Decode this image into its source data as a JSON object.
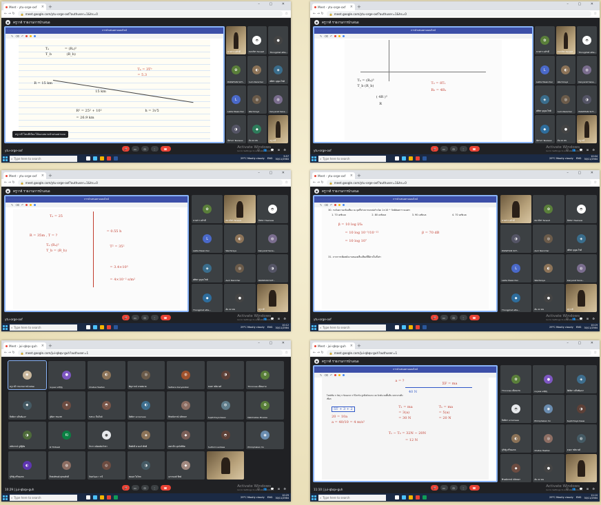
{
  "browser": {
    "tab_title": "Meet - ytu-orge-oxf",
    "tab_title_jui": "Meet - jui-qbqv-guh",
    "new_tab": "+",
    "window_controls": "–  ▢  ✕",
    "nav": "←  →  ↻",
    "url": "meet.google.com/ytu-orge-oxf?authuser=1&hs=0",
    "url_jui": "meet.google.com/jui-qbqv-guh?authuser=1"
  },
  "meet": {
    "presenter_banner": "ครูวาดี รายงานการนำเสนอ",
    "slide_app_title": "การนำเสนอทางออนไลน์",
    "chat_caption": "ครูวาดี โหนทีเนียง ได้มอบหมายนำเสนอผ่านจอ",
    "meeting_code_1": "ytu-orge-oxf",
    "meeting_code_5": "10:29  |  jui-qbqv-guh",
    "meeting_code_6": "11:10  |  jui-qbqv-guh",
    "activate_line1": "Activate Windows",
    "activate_line2": "Go to Settings to activate Windows.",
    "controls": {
      "mic": "🎤",
      "cam": "▭",
      "cc": "⊡",
      "present": "⬚",
      "more": "⋮",
      "end": "☎"
    },
    "right_icons": "ⓘ 👥 💬 ⊞ ⚙"
  },
  "taskbar": {
    "search_placeholder": "Type here to search",
    "weather": "29°C  Mostly cloudy",
    "lang": "ENG",
    "time_1": "9:57",
    "time_2": "10:04",
    "time_3": "10:12",
    "time_4": "10:19",
    "time_5": "10:29",
    "time_6": "11:10",
    "date": "30/11/2564"
  },
  "participants_a": [
    "นางสาว อภิรดี",
    "ธนาภัทร Tanasit",
    "Thongphat atte...",
    "PAKWHAN SUT...",
    "Aum Nanichar",
    "ศศิพร บุญยะโชติ",
    "Lalita Meanchai",
    "Wachiraya",
    "Kanyarat Sana...",
    "ฉัตรมา Tawisaw",
    "อัน 22 คน",
    "ครูวาดี"
  ],
  "participants_b": [
    "ครูวาดี รายงานการนำเสนอ",
    "nuyew sdfjfg",
    "Chatsa Hasitan",
    "ธัญการณ์ ลายพยาต",
    "Settana Kanyaratan",
    "ธนดา ขติยวงศ์",
    "Thronnaa เดือนงาม",
    "ปิยธิดา นลีนพัฒนา",
    "ปุณิตา ขนะพร",
    "Tufion ปีนจีนย์",
    "ปิยธิดา sriramsaa",
    "ฟิรดยังกรณ์ ปธัทธยา",
    "Supitchaya Kaew",
    "Natchwilas Pinwaw",
    "หทัยกาณ์ ภูมิฐิดิย",
    "KI Thitiwat",
    "จิรภา ธนัตตย์แก้วชา",
    "ธีทศักดิ์ ดวงแก้วสิทธิ์",
    "เทศวลีก มุกก์สสิษิต",
    "Sudtom Lantasa",
    "Phimphakan Yui",
    "ปุริทัฐ ศรีทองกล",
    "ธีรพงษ์ชนค์ ศุภณศักดิ์",
    "จินตวัฒนา วานี",
    "สมเอส ใยไชล",
    "เอรกนนท์ ทีตย์"
  ],
  "math": {
    "s1": [
      "Tₐ",
      "= (Rₐ)²",
      "T_b",
      "(R_b)",
      "Tₐ = 3Tᵇ",
      "= 5.3",
      "R = 15 km",
      "h = 4R",
      "15 km",
      "R² = 25² + 10²",
      "h = 3√5",
      "= 26.9 km"
    ],
    "s2": [
      "Tₐ = (Rₐ)³",
      "T_b   (R_b)",
      "T₂ = 8T₁",
      "R₂ = 4R₁",
      "( 4R )³",
      "R"
    ],
    "s3": [
      "Tₐ = 25",
      "= 0.55 h",
      "R = 35m ,  T = ?",
      "Tₐ  (Rₐ)²",
      "T_b = (R_b)",
      "T² = 35²",
      "= 3.4×10⁵",
      "= 4×10⁻² s/m²"
    ],
    "s4": [
      "30. ระดับความเข้มเสียง ณ จุดที่ห่างจากแหล่งกำเนิด 1×10⁻⁵ วัตต์ต่อตารางเมตร",
      "1. 70 เดซิเบล",
      "2. 80 เดซิเบล",
      "3. 90 เดซิเบล",
      "4. 70 เดซิเบล",
      "β = 10 log I/I₀",
      "= 10 log 10⁻⁵/10⁻¹²",
      "= 10 log 10⁷",
      "β = 70 dB",
      "31. จากการเพิ่มพลังงานของคลื่นเสียงที่มีค่าเป็นกี่เท่า"
    ],
    "s6": [
      "a = ?",
      "ΣF = ma",
      "40 N",
      "5T + 3 + 2",
      "T₁ = ma",
      "= 3(a)",
      "= 30 N",
      "Tₙ = ma",
      "= 5(a)",
      "= 20 N",
      "20 = 10a",
      "a = 40/10 = 4 m/s²",
      "T₁ − T₂ = 32N − 20N",
      "= 12 N"
    ],
    "s6_text": "โจทย์ข้อ 3 วัตถุ 3 ก้อนมวล 3 กิโลกรัม ถูกดึงด้วยแรง 40 นิวตัน บนพื้นลื่น จงหาแรงตึงเชือก"
  }
}
